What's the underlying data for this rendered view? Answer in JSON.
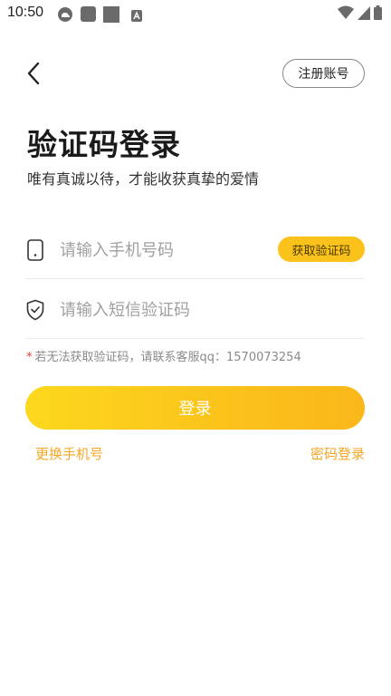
{
  "status_bar": {
    "time": "10:50",
    "left_icons": [
      "cloud-icon",
      "square-icon",
      "square-icon",
      "text-a-icon"
    ],
    "right_icons": [
      "wifi-icon",
      "signal-icon",
      "battery-icon"
    ]
  },
  "header": {
    "back_icon": "chevron-left-icon",
    "register_label": "注册账号"
  },
  "title": "验证码登录",
  "subtitle": "唯有真诚以待，才能收获真挚的爱情",
  "phone_field": {
    "icon": "phone-icon",
    "placeholder": "请输入手机号码",
    "value": "",
    "get_code_label": "获取验证码"
  },
  "code_field": {
    "icon": "shield-check-icon",
    "placeholder": "请输入短信验证码",
    "value": ""
  },
  "hint": {
    "star": "*",
    "text": "若无法获取验证码，请联系客服qq：1570073254"
  },
  "login_label": "登录",
  "links": {
    "change_phone": "更换手机号",
    "password_login": "密码登录"
  },
  "colors": {
    "accent": "#fcc21c",
    "link": "#f5a623",
    "hint_star": "#e53935"
  }
}
